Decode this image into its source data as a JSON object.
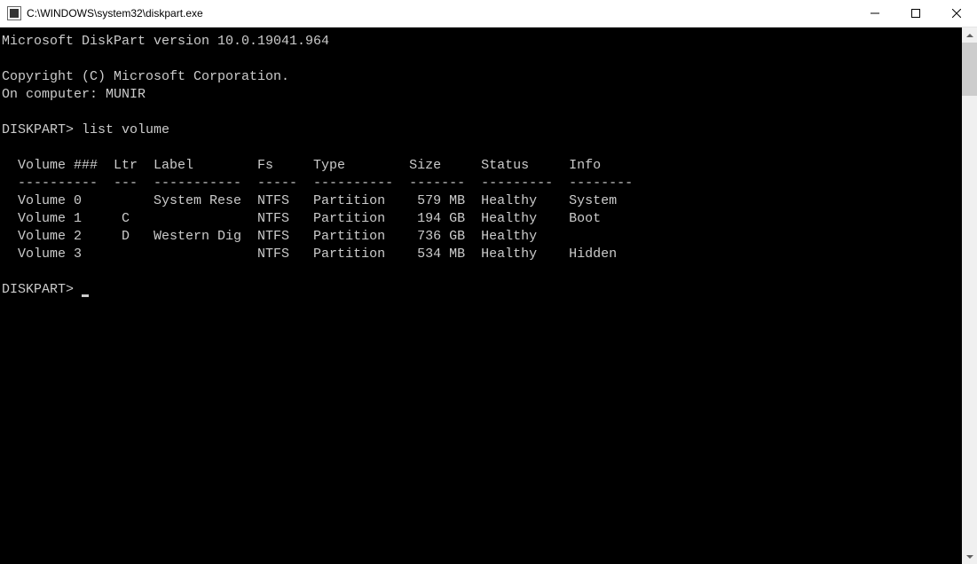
{
  "window": {
    "title": "C:\\WINDOWS\\system32\\diskpart.exe"
  },
  "console": {
    "header_version": "Microsoft DiskPart version 10.0.19041.964",
    "copyright": "Copyright (C) Microsoft Corporation.",
    "computer": "On computer: MUNIR",
    "prompt1": "DISKPART> list volume",
    "table_header": "  Volume ###  Ltr  Label        Fs     Type        Size     Status     Info",
    "table_divider": "  ----------  ---  -----------  -----  ----------  -------  ---------  --------",
    "rows": [
      "  Volume 0         System Rese  NTFS   Partition    579 MB  Healthy    System",
      "  Volume 1     C                NTFS   Partition    194 GB  Healthy    Boot",
      "  Volume 2     D   Western Dig  NTFS   Partition    736 GB  Healthy",
      "  Volume 3                      NTFS   Partition    534 MB  Healthy    Hidden"
    ],
    "prompt2": "DISKPART> "
  },
  "volumes_structured": [
    {
      "num": "Volume 0",
      "ltr": "",
      "label": "System Rese",
      "fs": "NTFS",
      "type": "Partition",
      "size": "579 MB",
      "status": "Healthy",
      "info": "System"
    },
    {
      "num": "Volume 1",
      "ltr": "C",
      "label": "",
      "fs": "NTFS",
      "type": "Partition",
      "size": "194 GB",
      "status": "Healthy",
      "info": "Boot"
    },
    {
      "num": "Volume 2",
      "ltr": "D",
      "label": "Western Dig",
      "fs": "NTFS",
      "type": "Partition",
      "size": "736 GB",
      "status": "Healthy",
      "info": ""
    },
    {
      "num": "Volume 3",
      "ltr": "",
      "label": "",
      "fs": "NTFS",
      "type": "Partition",
      "size": "534 MB",
      "status": "Healthy",
      "info": "Hidden"
    }
  ]
}
